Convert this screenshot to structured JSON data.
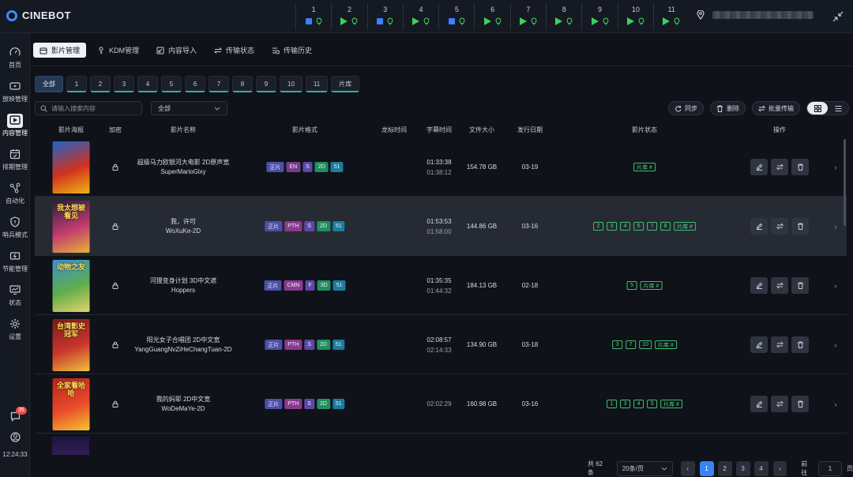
{
  "app": {
    "title": "CINEBOT",
    "accent": "#3d8bff"
  },
  "screens": [
    {
      "num": "1",
      "state": "stopped"
    },
    {
      "num": "2",
      "state": "playing"
    },
    {
      "num": "3",
      "state": "stopped"
    },
    {
      "num": "4",
      "state": "playing"
    },
    {
      "num": "5",
      "state": "stopped"
    },
    {
      "num": "6",
      "state": "playing"
    },
    {
      "num": "7",
      "state": "playing"
    },
    {
      "num": "8",
      "state": "playing"
    },
    {
      "num": "9",
      "state": "playing"
    },
    {
      "num": "10",
      "state": "playing"
    },
    {
      "num": "11",
      "state": "playing"
    }
  ],
  "sidebar": {
    "items": [
      {
        "label": "首页",
        "icon": "dashboard-icon"
      },
      {
        "label": "放映管理",
        "icon": "projector-icon"
      },
      {
        "label": "内容管理",
        "icon": "film-icon"
      },
      {
        "label": "排期管理",
        "icon": "calendar-icon"
      },
      {
        "label": "自动化",
        "icon": "flow-icon"
      },
      {
        "label": "哨兵模式",
        "icon": "shield-icon"
      },
      {
        "label": "节能管理",
        "icon": "energy-icon"
      },
      {
        "label": "状态",
        "icon": "monitor-icon"
      },
      {
        "label": "设置",
        "icon": "gear-icon"
      }
    ],
    "message_badge": "35",
    "clock": "12:24:33"
  },
  "tabs": [
    "影片管理",
    "KDM管理",
    "内容导入",
    "传输状态",
    "传输历史"
  ],
  "filters": [
    "全部",
    "1",
    "2",
    "3",
    "4",
    "5",
    "6",
    "7",
    "8",
    "9",
    "10",
    "11",
    "片库"
  ],
  "toolbar": {
    "search_placeholder": "请输入搜索内容",
    "type_select": "全部",
    "sync": "同步",
    "delete": "删除",
    "batch_transfer": "批量传输"
  },
  "columns": {
    "poster": "影片海报",
    "encrypt": "加密",
    "name": "影片名称",
    "format": "影片格式",
    "dragon_time": "龙标时间",
    "subtitle_time": "字幕时间",
    "size": "文件大小",
    "release": "发行日期",
    "status": "影片状态",
    "ops": "操作"
  },
  "films": [
    {
      "cn": "超级马力欧银河大电影 2D原声宽",
      "en": "SuperMarioGlxy",
      "formats": [
        "正片",
        "EN",
        "S",
        "2D",
        "51"
      ],
      "time1": "01:33:38",
      "time2": "01:38:12",
      "size": "154.78 GB",
      "date": "03-19",
      "status": [
        "片库 #"
      ],
      "poster_colors": [
        "#1e63c9",
        "#d0321e",
        "#f2b418"
      ],
      "poster_text": ""
    },
    {
      "cn": "我，许可",
      "en": "WoXuKe-2D",
      "formats": [
        "正片",
        "PTH",
        "S",
        "2D",
        "51"
      ],
      "time1": "01:53:53",
      "time2": "01:58:00",
      "size": "144.86 GB",
      "date": "03-16",
      "status": [
        "2",
        "3",
        "4",
        "5",
        "7",
        "8",
        "片库 #"
      ],
      "poster_colors": [
        "#2a1e3a",
        "#c13b6f",
        "#e5b43a"
      ],
      "poster_text": "我太想被看见"
    },
    {
      "cn": "河狸变身计划 3D中文遮",
      "en": "Hoppers",
      "formats": [
        "正片",
        "CMN",
        "F",
        "3D",
        "51"
      ],
      "time1": "01:35:35",
      "time2": "01:44:32",
      "size": "184.13 GB",
      "date": "02-18",
      "status": [
        "5",
        "片库 #"
      ],
      "poster_colors": [
        "#3a8fd0",
        "#5fae4a",
        "#e7d36a"
      ],
      "poster_text": "动物之友"
    },
    {
      "cn": "阳光女子合唱团 2D中文宽",
      "en": "YangGuangNvZiHeChangTuan-2D",
      "formats": [
        "正片",
        "PTH",
        "S",
        "2D",
        "51"
      ],
      "time1": "02:08:57",
      "time2": "02:14:33",
      "size": "134.90 GB",
      "date": "03-18",
      "status": [
        "3",
        "7",
        "10",
        "片库 #"
      ],
      "poster_colors": [
        "#7a1a1a",
        "#c9362e",
        "#f0c23c"
      ],
      "poster_text": "台湾影史冠军"
    },
    {
      "cn": "我的妈耶 2D中文宽",
      "en": "WoDeMaYe-2D",
      "formats": [
        "正片",
        "PTH",
        "S",
        "2D",
        "51"
      ],
      "time1": "",
      "time2": "02:02:29",
      "size": "160.98 GB",
      "date": "03-16",
      "status": [
        "1",
        "3",
        "4",
        "5",
        "片库 #"
      ],
      "poster_colors": [
        "#b7221c",
        "#e94a2a",
        "#f4c52f"
      ],
      "poster_text": "全家看哈哈"
    }
  ],
  "pagination": {
    "total": "共 62 条",
    "page_size": "20条/页",
    "pages": [
      "1",
      "2",
      "3",
      "4"
    ],
    "current": "1",
    "goto_label": "前往",
    "goto_value": "1",
    "page_suffix": "页"
  }
}
